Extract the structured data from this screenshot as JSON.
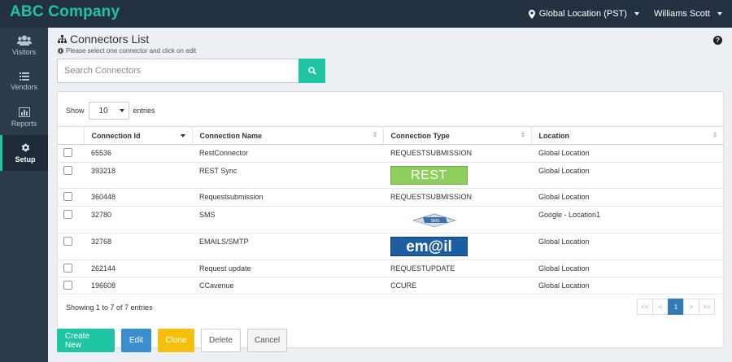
{
  "app": {
    "brand": "ABC Company"
  },
  "topbar": {
    "location": "Global Location (PST)",
    "user": "Williams Scott"
  },
  "sidebar": {
    "items": [
      {
        "label": "Visitors",
        "icon": "users-icon",
        "active": false
      },
      {
        "label": "Vendors",
        "icon": "list-icon",
        "active": false
      },
      {
        "label": "Reports",
        "icon": "bar-chart-icon",
        "active": false
      },
      {
        "label": "Setup",
        "icon": "gear-icon",
        "active": true
      }
    ]
  },
  "page": {
    "title": "Connectors List",
    "subtitle": "Please select one connector and click on edit"
  },
  "search": {
    "placeholder": "Search Connectors"
  },
  "table": {
    "length_show": "Show",
    "length_value": "10",
    "length_entries": "entries",
    "columns": [
      "Connection Id",
      "Connection Name",
      "Connection Type",
      "Location"
    ],
    "rows": [
      {
        "id": "65536",
        "name": "RestConnector",
        "type": "REQUESTSUBMISSION",
        "type_logo": "",
        "location": "Global Location"
      },
      {
        "id": "393218",
        "name": "REST Sync",
        "type": "REST",
        "type_logo": "rest",
        "location": "Global Location"
      },
      {
        "id": "360448",
        "name": "Requestsubmission",
        "type": "REQUESTSUBMISSION",
        "type_logo": "",
        "location": "Global Location"
      },
      {
        "id": "32780",
        "name": "SMS",
        "type": "SMS",
        "type_logo": "sms",
        "location": "Google - Location1"
      },
      {
        "id": "32768",
        "name": "EMAILS/SMTP",
        "type": "em@il",
        "type_logo": "email",
        "location": "Global Location"
      },
      {
        "id": "262144",
        "name": "Request update",
        "type": "REQUESTUPDATE",
        "type_logo": "",
        "location": "Global Location"
      },
      {
        "id": "196608",
        "name": "CCavenue",
        "type": "CCURE",
        "type_logo": "",
        "location": "Global Location"
      }
    ],
    "info": "Showing 1 to 7 of 7 entries",
    "pagination": {
      "first": "<<",
      "prev": "<",
      "current": "1",
      "next": ">",
      "last": ">>"
    }
  },
  "actions": {
    "create": "Create New",
    "edit": "Edit",
    "clone": "Clone",
    "delete": "Delete",
    "cancel": "Cancel"
  },
  "colors": {
    "accent": "#1fc4a3",
    "topbar": "#233142",
    "sidebar": "#2c3b4c",
    "edit": "#3c8dcd",
    "clone": "#f5c00b",
    "page_active": "#337ab7"
  }
}
